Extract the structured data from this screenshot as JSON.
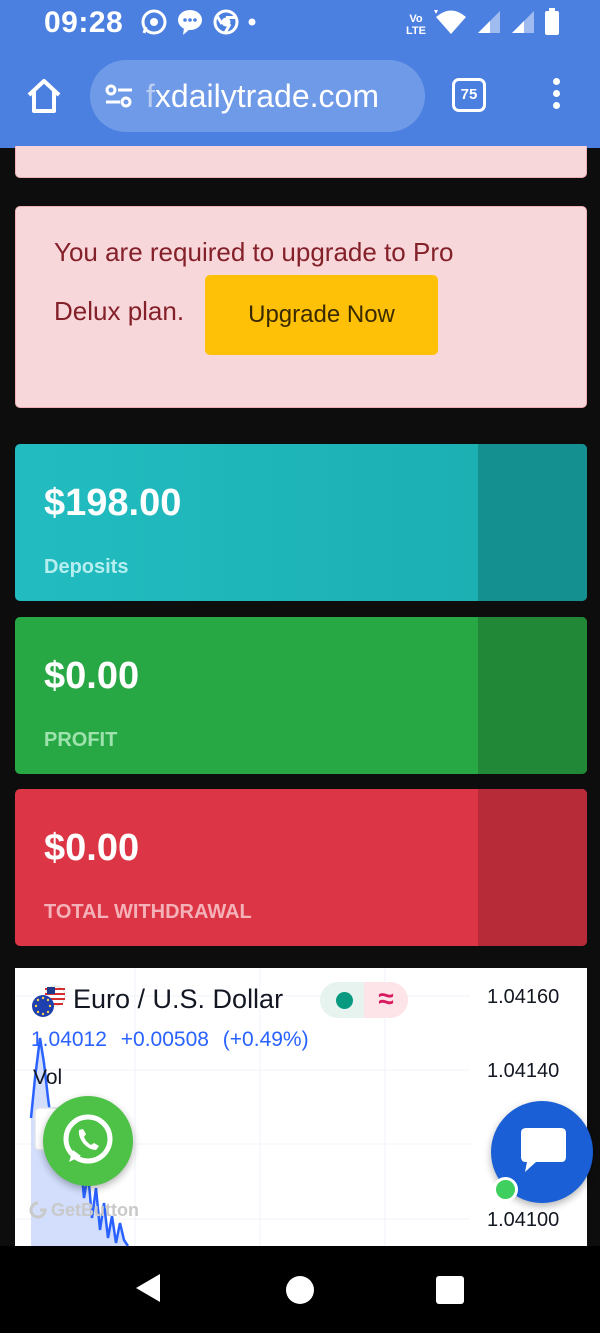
{
  "status_bar": {
    "time": "09:28",
    "volte_top": "Vo",
    "volte_bottom": "LTE",
    "icons": [
      "whatsapp-icon",
      "messenger-icon",
      "chrome-icon",
      "notification-dot-icon",
      "volte-icon",
      "wifi-icon",
      "signal-icon",
      "signal-icon",
      "battery-icon"
    ]
  },
  "browser": {
    "url_faded": "f",
    "url_domain": "xdailytrade.com",
    "tab_count": "75",
    "icons": [
      "home-icon",
      "site-settings-icon",
      "tabs-icon",
      "more-vert-icon"
    ]
  },
  "alert": {
    "line1": "You are required to upgrade to Pro",
    "line2": "Delux plan.",
    "button_label": "Upgrade Now"
  },
  "stats": {
    "deposits": {
      "value": "$198.00",
      "label": "Deposits"
    },
    "profit": {
      "value": "$0.00",
      "label": "PROFIT"
    },
    "withdrawal": {
      "value": "$0.00",
      "label": "TOTAL WITHDRAWAL"
    }
  },
  "chart_widget": {
    "symbol": "Euro / U.S. Dollar",
    "price": "1.04012",
    "change": "+0.00508",
    "change_pct": "(+0.49%)",
    "vol_label": "Vol",
    "wave_glyph": "≈",
    "watermark": "GetButton",
    "price_axis": [
      "1.04160",
      "1.04140",
      "1.04100"
    ]
  },
  "colors": {
    "browser_blue": "#4b7fe0",
    "alert_bg": "#f8d7da",
    "alert_text": "#842029",
    "upgrade_yellow": "#ffc107",
    "deposits_teal": "#22bcc0",
    "profit_green": "#28a745",
    "withdrawal_red": "#dc3545",
    "price_blue": "#2962ff"
  }
}
